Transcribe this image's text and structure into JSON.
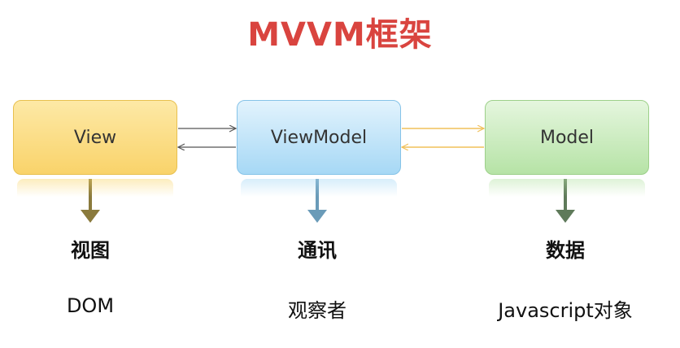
{
  "title": "MVVM框架",
  "boxes": {
    "view": "View",
    "viewmodel": "ViewModel",
    "model": "Model"
  },
  "layers": {
    "view": {
      "name": "视图",
      "tech": "DOM"
    },
    "viewmodel": {
      "name": "通讯",
      "tech": "观察者"
    },
    "model": {
      "name": "数据",
      "tech": "Javascript对象"
    }
  },
  "colors": {
    "title": "#d9443f",
    "view_box": "#f9d36a",
    "viewmodel_box": "#a6d8f5",
    "model_box": "#b6e3a6",
    "view_arrow": "#8a7a3c",
    "viewmodel_arrow": "#6a9bb8",
    "model_arrow": "#5f7a5a",
    "view_vm_link": "#555555",
    "vm_model_link": "#f0c05a"
  }
}
